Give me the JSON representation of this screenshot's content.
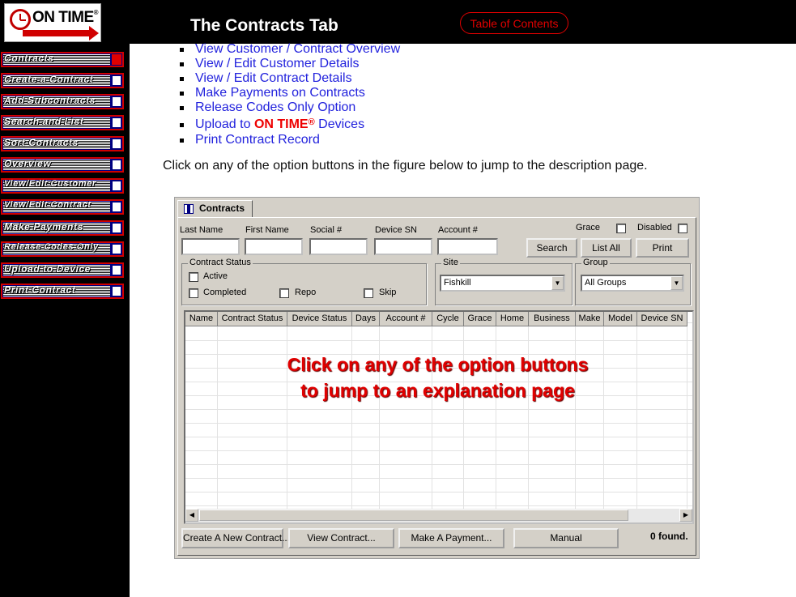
{
  "header": {
    "logo_text": "ON TIME",
    "logo_reg": "®",
    "title": "The Contracts Tab",
    "toc_label": "Table of Contents"
  },
  "sidebar": {
    "items": [
      {
        "label": "Contracts",
        "active": true
      },
      {
        "label": "Create a Contract",
        "active": false
      },
      {
        "label": "Add Subcontracts",
        "active": false
      },
      {
        "label": "Search and List",
        "active": false
      },
      {
        "label": "Sort Contracts",
        "active": false
      },
      {
        "label": "Overview",
        "active": false
      },
      {
        "label": "View/Edit Customer",
        "active": false
      },
      {
        "label": "View/Edit Contract",
        "active": false
      },
      {
        "label": "Make Payments",
        "active": false
      },
      {
        "label": "Release Codes Only",
        "active": false
      },
      {
        "label": "Upload to Device",
        "active": false
      },
      {
        "label": "Print Contract",
        "active": false
      }
    ]
  },
  "content": {
    "links": [
      "View Customer / Contract Overview",
      "View / Edit Customer Details",
      "View / Edit Contract Details",
      "Make Payments on Contracts",
      "Release Codes Only Option"
    ],
    "upload_link": {
      "prefix": "Upload to ",
      "brand": "ON TIME",
      "reg": "®",
      "suffix": " Devices"
    },
    "print_link": "Print Contract Record",
    "instruction": "Click on any of the option buttons in the figure below to jump to the description page."
  },
  "window": {
    "tab_label": "Contracts",
    "fields": {
      "last_name": "Last Name",
      "first_name": "First Name",
      "social": "Social #",
      "device_sn": "Device SN",
      "account": "Account #"
    },
    "grace_label": "Grace",
    "disabled_label": "Disabled",
    "buttons": {
      "search": "Search",
      "list_all": "List All",
      "print": "Print"
    },
    "status_group": {
      "title": "Contract Status",
      "active": "Active",
      "completed": "Completed",
      "repo": "Repo",
      "skip": "Skip"
    },
    "site": {
      "title": "Site",
      "value": "Fishkill"
    },
    "group": {
      "title": "Group",
      "value": "All Groups"
    },
    "columns": [
      "Name",
      "Contract Status",
      "Device Status",
      "Days",
      "Account #",
      "Cycle",
      "Grace",
      "Home",
      "Business",
      "Make",
      "Model",
      "Device SN"
    ],
    "overlay": [
      "Click on any of the option buttons",
      "to jump to an explanation page"
    ],
    "bottom_buttons": {
      "new_contract": "Create A New Contract...",
      "view_contract": "View Contract...",
      "make_payment": "Make A Payment...",
      "manual": "Manual"
    },
    "found": "0 found."
  },
  "colors": {
    "accent_red": "#e00000",
    "link_blue": "#2222dd",
    "nav_blue": "#000080"
  }
}
